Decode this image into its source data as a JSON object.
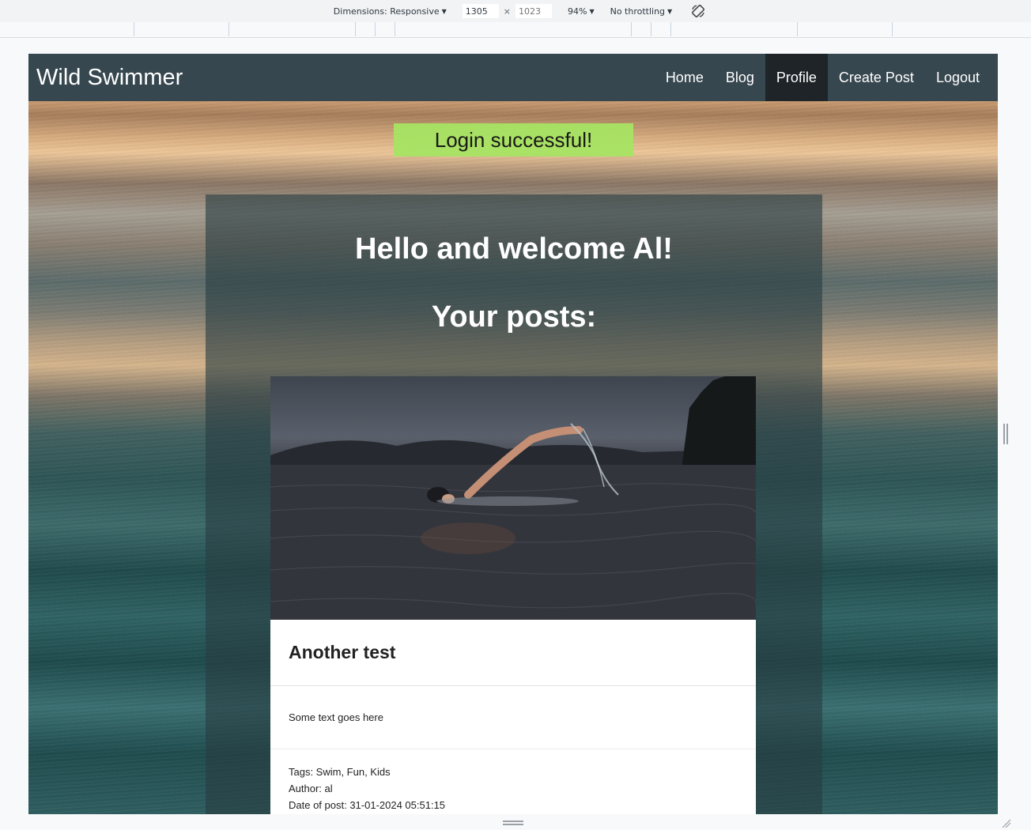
{
  "devtools": {
    "dimensions_label": "Dimensions: Responsive",
    "width_value": "1305",
    "height_placeholder": "1023",
    "times_symbol": "×",
    "zoom": "94%",
    "throttling": "No throttling",
    "rotate_icon": "rotate-icon"
  },
  "site": {
    "brand": "Wild Swimmer",
    "nav": [
      {
        "label": "Home",
        "active": false
      },
      {
        "label": "Blog",
        "active": false
      },
      {
        "label": "Profile",
        "active": true
      },
      {
        "label": "Create Post",
        "active": false
      },
      {
        "label": "Logout",
        "active": false
      }
    ]
  },
  "flash": {
    "message": "Login successful!",
    "color": "#a6e463"
  },
  "profile": {
    "welcome": "Hello and welcome Al!",
    "posts_heading": "Your posts:"
  },
  "post": {
    "image": "swimmer-photo",
    "title": "Another test",
    "body": "Some text goes here",
    "tags": "Tags: Swim, Fun, Kids",
    "author": "Author: al",
    "date": "Date of post: 31-01-2024 05:51:15"
  },
  "colors": {
    "navbar": "#37474f",
    "nav_active": "#1e2428",
    "panel_overlay": "rgba(40,62,66,0.62)"
  }
}
